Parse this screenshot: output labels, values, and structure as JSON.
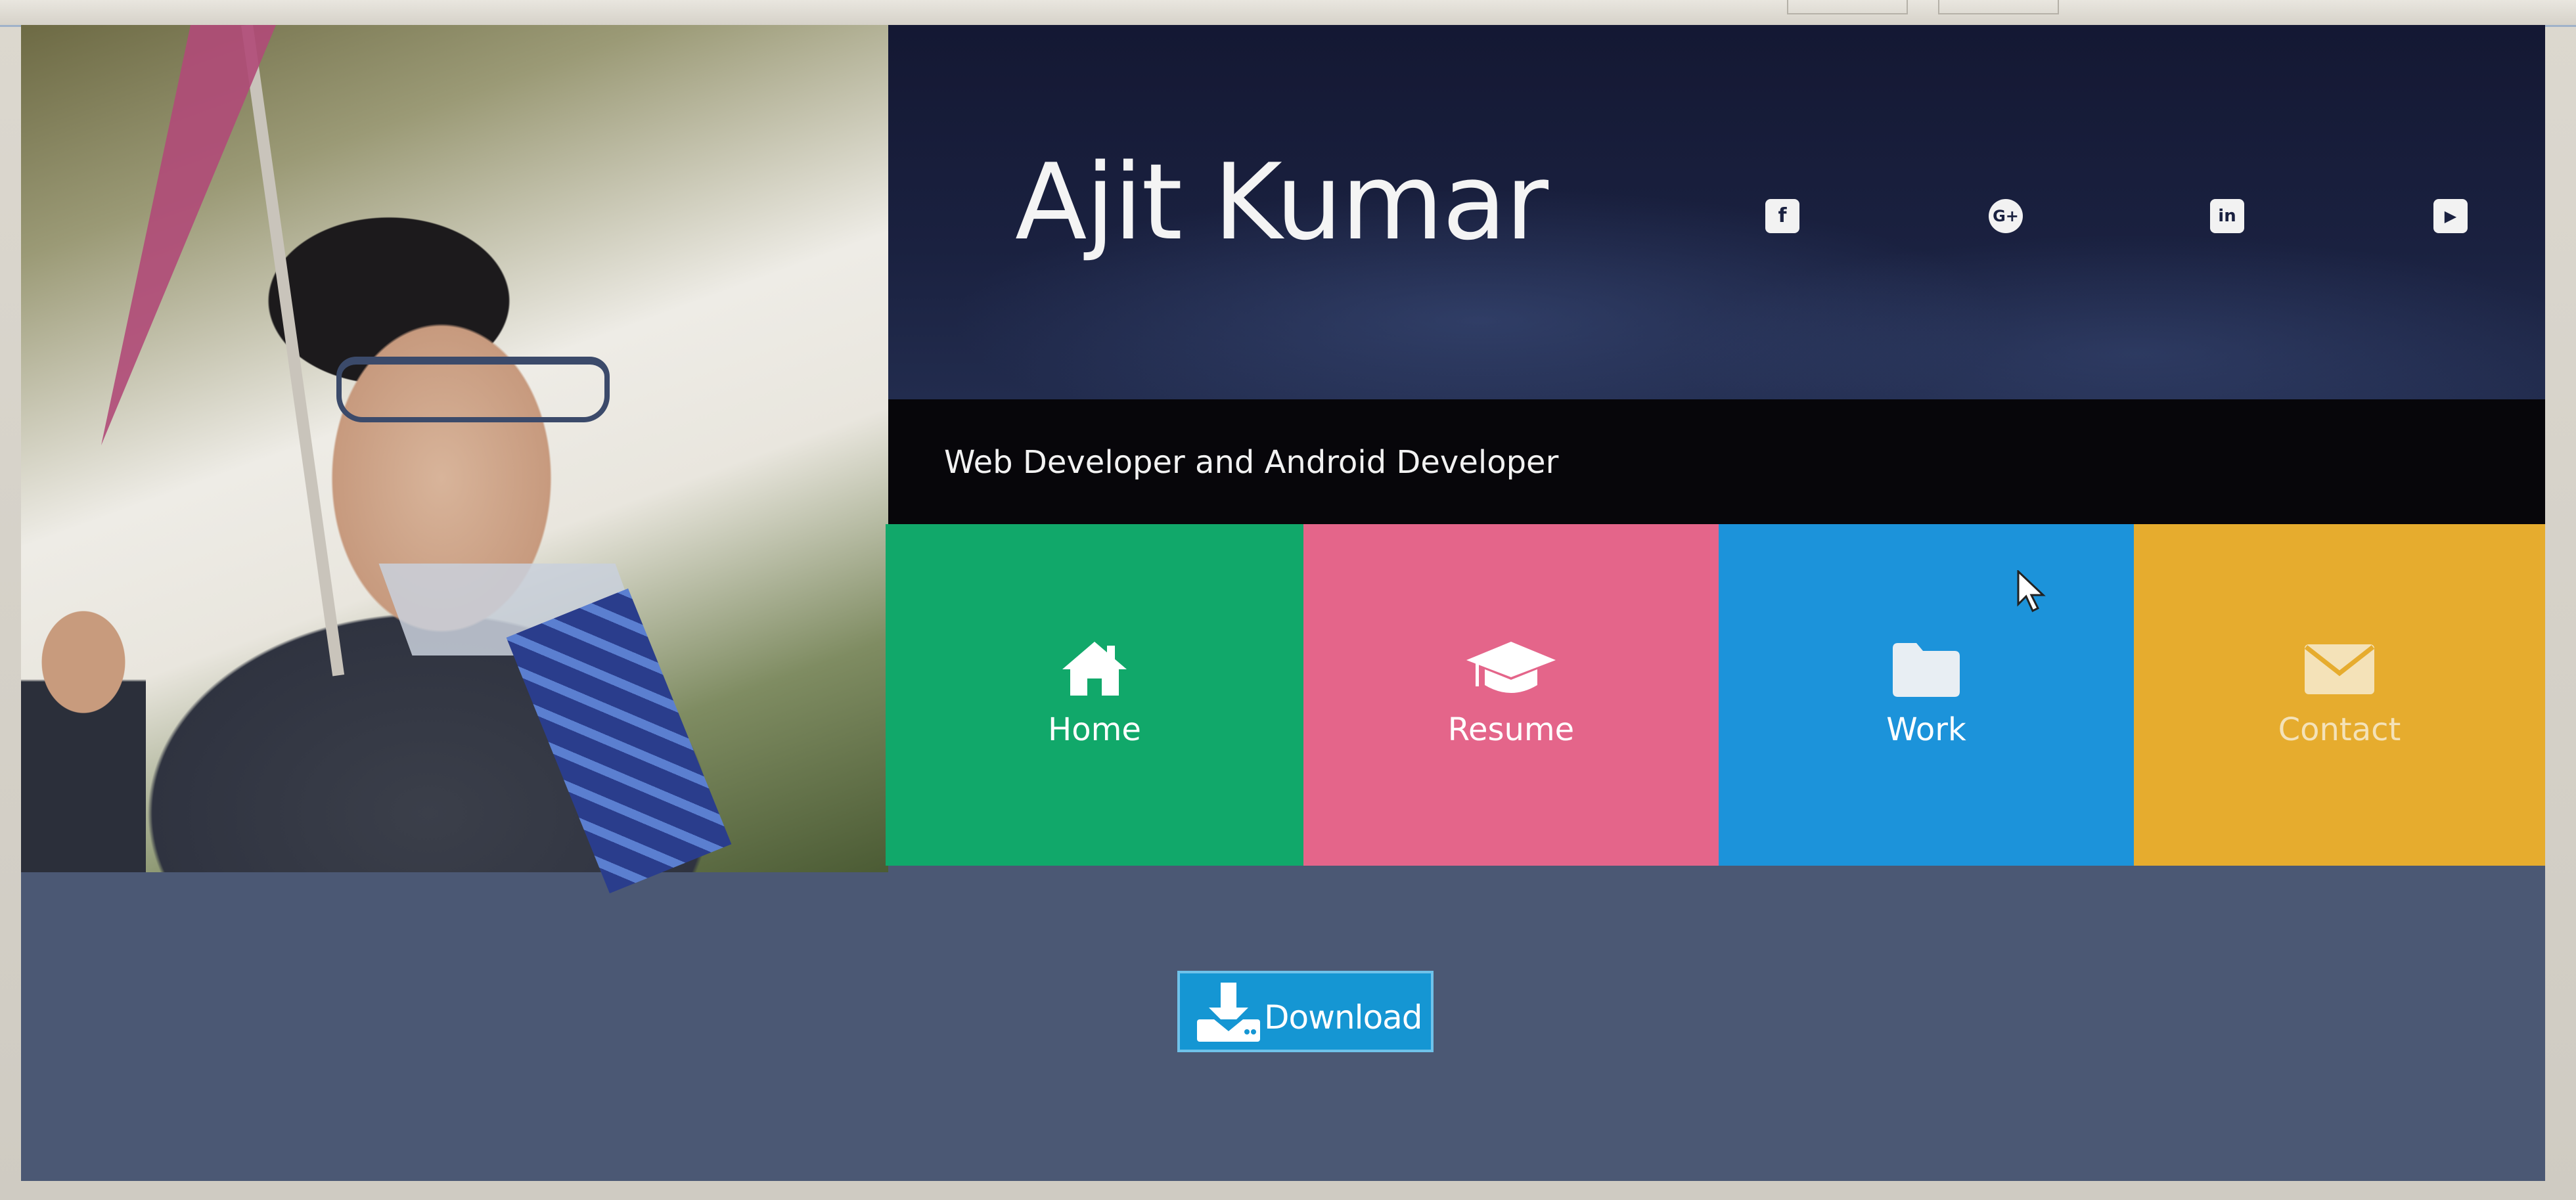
{
  "header": {
    "name": "Ajit Kumar",
    "tagline": "Web Developer and Android Developer"
  },
  "social": [
    {
      "icon": "facebook-icon",
      "glyph": "f"
    },
    {
      "icon": "google-plus-icon",
      "glyph": "G+"
    },
    {
      "icon": "linkedin-icon",
      "glyph": "in"
    },
    {
      "icon": "youtube-icon",
      "glyph": "▶"
    }
  ],
  "tiles": [
    {
      "label": "Home",
      "icon": "home-icon",
      "color": "#11a86a"
    },
    {
      "label": "Resume",
      "icon": "graduation-cap-icon",
      "color": "#e4658a"
    },
    {
      "label": "Work",
      "icon": "folder-icon",
      "color": "#1c93da"
    },
    {
      "label": "Contact",
      "icon": "envelope-icon",
      "color": "#e6ac2e"
    }
  ],
  "download": {
    "label": "Download",
    "icon": "download-icon",
    "color": "#1596d3"
  },
  "colors": {
    "header_bg": "#1a2140",
    "tagline_bg": "#07060a",
    "page_bg": "#4b5874"
  }
}
